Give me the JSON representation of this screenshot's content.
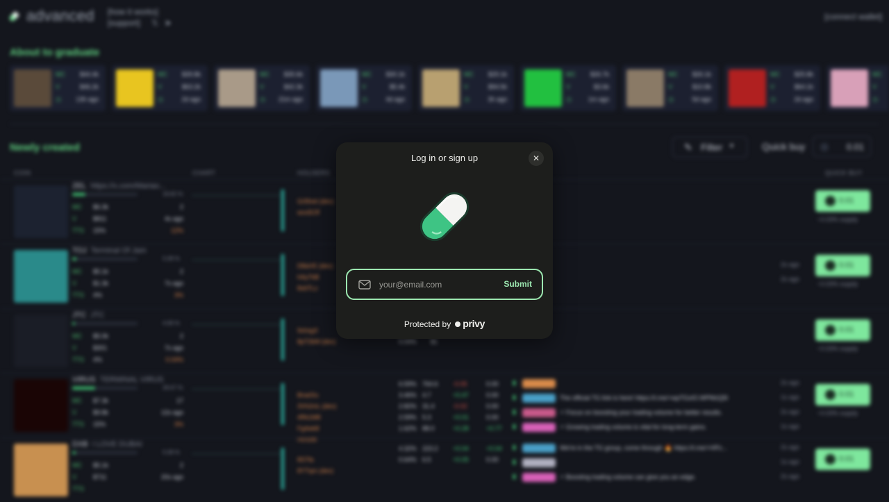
{
  "header": {
    "brand": "advanced",
    "link_how": "[how it works]",
    "link_support": "[support]",
    "social_x": "𝕏",
    "social_tg": "➤",
    "connect_wallet": "[connect wallet]"
  },
  "sections": {
    "graduate_title": "About to graduate",
    "new_title": "Newly created"
  },
  "graduate_cards": [
    {
      "mc": "$44.4k",
      "v": "$46.2k",
      "age": "13h ago",
      "color": "#5a4a3a"
    },
    {
      "mc": "$39.8k",
      "v": "$63.2k",
      "age": "2d ago",
      "color": "#e8c520"
    },
    {
      "mc": "$35.6k",
      "v": "$42.3k",
      "age": "21m ago",
      "color": "#a99a88"
    },
    {
      "mc": "$30.1k",
      "v": "$5.4k",
      "age": "4d ago",
      "color": "#7a98b8"
    },
    {
      "mc": "$29.1k",
      "v": "$94.5k",
      "age": "3h ago",
      "color": "#b8a070"
    },
    {
      "mc": "$26.7k",
      "v": "$3.6k",
      "age": "1m ago",
      "color": "#22c040"
    },
    {
      "mc": "$26.1k",
      "v": "$10.8k",
      "age": "5d ago",
      "color": "#8a7a66"
    },
    {
      "mc": "$25.8k",
      "v": "$64.1k",
      "age": "2d ago",
      "color": "#b02020"
    },
    {
      "mc": "$24.2k",
      "v": "$21.4k",
      "age": "3d ago",
      "color": "#d8a0b8"
    }
  ],
  "labels": {
    "mc": "MC",
    "v": "V",
    "tts": "TTS",
    "dh": "DH"
  },
  "toolbar": {
    "filter_label": "Filter",
    "quick_buy_label": "Quick buy",
    "quick_buy_value": "0.01"
  },
  "columns": {
    "coin": "COIN",
    "chart": "CHART",
    "holders": "HOLDERS",
    "quick_buy": "QUICK BUY"
  },
  "rows": [
    {
      "symbol": "ZEL",
      "name": "https://x.com/Mariao...",
      "progress": 0.2,
      "pct": "18.82 %",
      "mc": "$6.3k",
      "v": "$811",
      "tts": "15%",
      "holders_count": "2",
      "age": "4s ago",
      "dh": "12%",
      "extra": "0",
      "thumb": "#1c2230",
      "holders": [
        "Gr5fvet (dev)",
        "wvx5Cff"
      ],
      "buy": "0.01",
      "supply": "~0.03% supply",
      "activity": [],
      "times": []
    },
    {
      "symbol": "TOJ",
      "name": "Terminal Of Jam",
      "progress": 0.06,
      "pct": "5.08 %",
      "mc": "$5.1k",
      "v": "$1.3k",
      "tts": "4%",
      "holders_count": "2",
      "age": "7s ago",
      "dh": "3%",
      "extra": "0",
      "thumb": "#2a8a8a",
      "holders": [
        "D8aVE (dev)",
        "hAy7bB",
        "8xbTLz"
      ],
      "buy": "0.01",
      "supply": "~0.03% supply",
      "activity": [],
      "times": [
        "2s ago",
        "2s ago"
      ]
    },
    {
      "symbol": "JTC",
      "name": "JTC",
      "progress": 0.04,
      "pct": "4.69 %",
      "mc": "$5.0k",
      "v": "$301",
      "tts": "4%",
      "holders_count": "2",
      "age": "7s ago",
      "dh": "0.04%",
      "extra": "0",
      "thumb": "#1a1d26",
      "holders": [
        "9xhsgX",
        "8pT2kM (dev)"
      ],
      "stats_row": [
        "0.04%",
        "$1"
      ],
      "buy": "0.01",
      "supply": "~0.03% supply",
      "activity": [],
      "times": []
    },
    {
      "symbol": "VIRUS",
      "name": "TERMINAL VIRUS",
      "progress": 0.35,
      "pct": "28.67 %",
      "mc": "$7.3k",
      "v": "$9.8k",
      "tts": "15%",
      "holders_count": "17",
      "age": "12s ago",
      "dh": "3%",
      "extra": "33",
      "thumb": "#1a0505",
      "holders": [
        "BnarDu",
        "3Vh2mL (dev)",
        "4Rk1M8",
        "Fg4wk8",
        "Hcnz8t"
      ],
      "hold_rows": [
        [
          "6.59%",
          "764.6",
          "-0.05",
          "0.00"
        ],
        [
          "3.46%",
          "4.7",
          "+0.47",
          "0.00"
        ],
        [
          "2.82%",
          "31.4",
          "-0.02",
          "0.00"
        ],
        [
          "2.59%",
          "5.3",
          "+0.01",
          "0.00"
        ],
        [
          "1.62%",
          "88.0",
          "+0.28",
          "+0.77"
        ]
      ],
      "buy": "0.01",
      "supply": "~0.03% supply",
      "activity": [
        {
          "badge": "#d88a4a",
          "text": ""
        },
        {
          "badge": "#4aa0c8",
          "text": "The official TG link is here! https://t.me/+wpTGxIO.WPMzQ5l"
        },
        {
          "badge": "#c85a8a",
          "text": "⚡ Focus on boosting your trading volume for better results."
        },
        {
          "badge": "#d860b8",
          "text": "⚡ Growing trading volume is vital for long-term gains."
        }
      ],
      "times": [
        "2s ago",
        "1s ago",
        "2s ago",
        "1s ago"
      ]
    },
    {
      "symbol": "DXB",
      "name": "I LOVE DUBAI",
      "progress": 0.05,
      "pct": "5.08 %",
      "mc": "$5.1k",
      "v": "$711",
      "tts": "",
      "holders_count": "2",
      "age": "20s ago",
      "dh": "",
      "extra": "",
      "thumb": "#c89050",
      "holders": [
        "8S7fa",
        "8YTqm (dev)"
      ],
      "hold_rows": [
        [
          "4.32%",
          "223.2",
          "+0.04",
          "+0.04"
        ],
        [
          "0.64%",
          "6.5",
          "+0.05",
          "0.00"
        ]
      ],
      "buy": "0.01",
      "supply": "",
      "activity": [
        {
          "badge": "#4aa0c8",
          "text": "We're in the TG group, come through 🔥 https://t.me/+HPz..."
        },
        {
          "badge": "#b0b0c0",
          "text": ""
        },
        {
          "badge": "#d860b8",
          "text": "⚡ Boosting trading volume can give you an edge."
        }
      ],
      "times": [
        "2s ago",
        "1s ago",
        "2s ago"
      ]
    }
  ],
  "modal": {
    "title": "Log in or sign up",
    "close_glyph": "✕",
    "email_placeholder": "your@email.com",
    "submit_label": "Submit",
    "protected_by": "Protected by",
    "provider": "privy"
  },
  "colors": {
    "accent_green": "#9ce7b0",
    "pill_green": "#3ec484",
    "background": "#14161d",
    "modal_bg": "#1d1e1c"
  }
}
